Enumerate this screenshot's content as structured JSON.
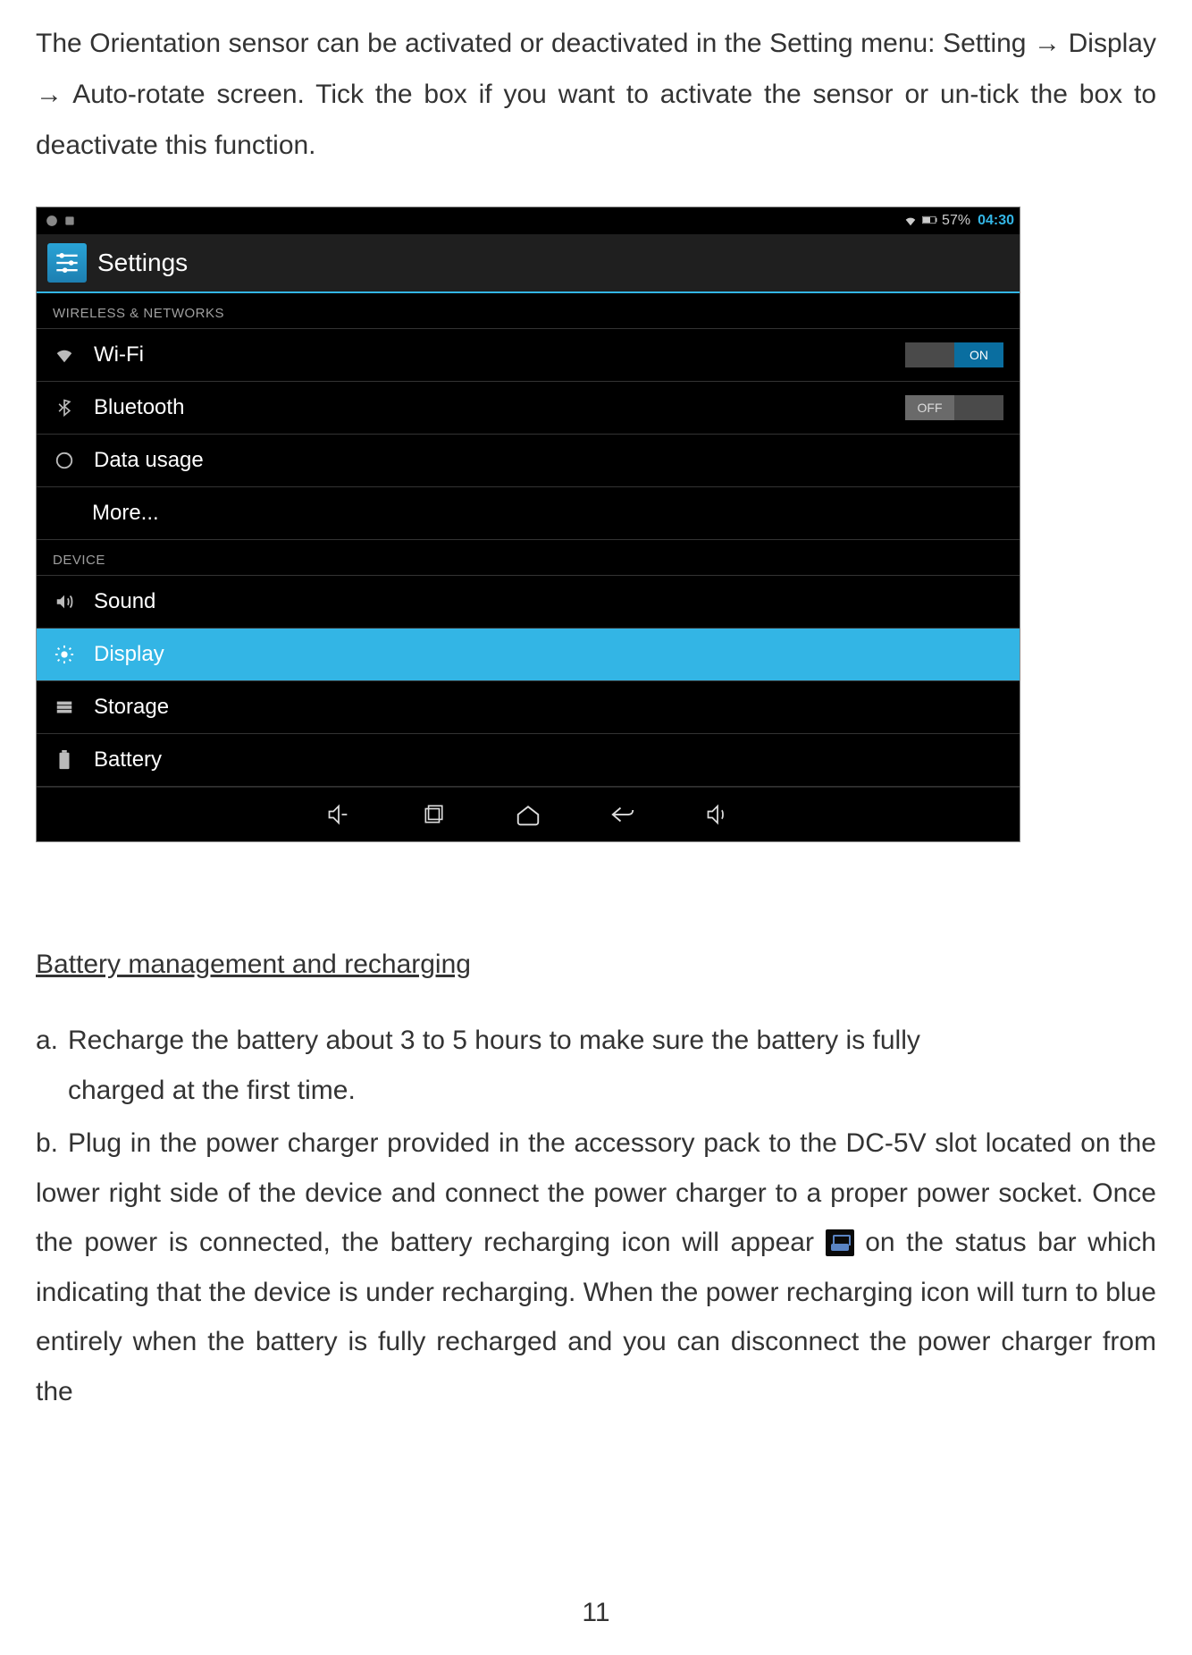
{
  "intro_text": "The Orientation sensor can be activated or deactivated in the Setting menu: Setting → Display → Auto-rotate screen.   Tick the box if you want to activate the sensor or un-tick the box to deactivate this function.",
  "screenshot": {
    "status_bar": {
      "battery_percent": "57%",
      "time": "04:30"
    },
    "header_title": "Settings",
    "section_wireless": "WIRELESS & NETWORKS",
    "wifi": {
      "label": "Wi-Fi",
      "toggle_on": "ON"
    },
    "bluetooth": {
      "label": "Bluetooth",
      "toggle_off": "OFF"
    },
    "data_usage": "Data usage",
    "more": "More...",
    "section_device": "DEVICE",
    "sound": "Sound",
    "display": "Display",
    "storage": "Storage",
    "battery": "Battery"
  },
  "heading": "Battery management and recharging",
  "list": {
    "a_marker": "a.",
    "a_text_line1": "Recharge the battery about 3 to 5 hours to make sure the battery is fully",
    "a_text_line2": "charged at the first time.",
    "b_marker": "b.",
    "b_text_part1": "Plug in the power charger provided in the accessory pack to the DC-5V slot located on the lower right side of the device and connect the power charger to a proper power socket.   Once the power is connected, the battery recharging icon will appear ",
    "b_text_part2": " on the status bar which indicating that the device is under recharging.   When the power recharging icon will turn to blue entirely when the battery is fully recharged and you can disconnect the power charger from the"
  },
  "page_number": "11"
}
